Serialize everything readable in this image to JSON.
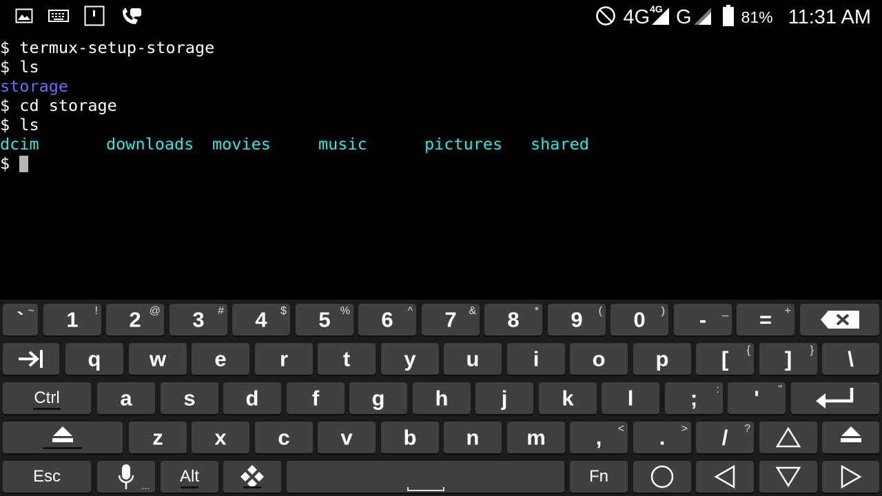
{
  "status_bar": {
    "battery": "81%",
    "time": "11:31 AM",
    "network_primary": "4G",
    "network_primary_tag": "4G",
    "network_secondary": "G",
    "left_icons": [
      "image-notification-icon",
      "keyboard-notification-icon",
      "sd-card-icon",
      "missed-call-icon"
    ]
  },
  "terminal": {
    "lines": [
      "$ termux-setup-storage",
      "$ ls",
      "storage",
      "$ cd storage",
      "$ ls"
    ],
    "ls_output": [
      "dcim",
      "downloads",
      "movies",
      "music",
      "pictures",
      "shared"
    ],
    "prompt": "$ ",
    "colors": {
      "directory_blue": "#6b6bff",
      "directory_cyan": "#2ee6e6",
      "text": "#ffffff",
      "background": "#000000"
    }
  },
  "keyboard": {
    "row1": [
      {
        "label": "`",
        "sub": "~"
      },
      {
        "label": "1",
        "sub": "!"
      },
      {
        "label": "2",
        "sub": "@"
      },
      {
        "label": "3",
        "sub": "#"
      },
      {
        "label": "4",
        "sub": "$"
      },
      {
        "label": "5",
        "sub": "%"
      },
      {
        "label": "6",
        "sub": "^"
      },
      {
        "label": "7",
        "sub": "&"
      },
      {
        "label": "8",
        "sub": "*"
      },
      {
        "label": "9",
        "sub": "("
      },
      {
        "label": "0",
        "sub": ")"
      },
      {
        "label": "-",
        "sub": "_"
      },
      {
        "label": "=",
        "sub": "+"
      }
    ],
    "row2": [
      {
        "label": "q"
      },
      {
        "label": "w"
      },
      {
        "label": "e"
      },
      {
        "label": "r"
      },
      {
        "label": "t"
      },
      {
        "label": "y"
      },
      {
        "label": "u"
      },
      {
        "label": "i"
      },
      {
        "label": "o"
      },
      {
        "label": "p"
      },
      {
        "label": "[",
        "sub": "{"
      },
      {
        "label": "]",
        "sub": "}"
      },
      {
        "label": "\\"
      }
    ],
    "row3": [
      {
        "label": "Ctrl"
      },
      {
        "label": "a"
      },
      {
        "label": "s"
      },
      {
        "label": "d"
      },
      {
        "label": "f"
      },
      {
        "label": "g"
      },
      {
        "label": "h"
      },
      {
        "label": "j"
      },
      {
        "label": "k"
      },
      {
        "label": "l"
      },
      {
        "label": ";",
        "sub": ":"
      },
      {
        "label": "'",
        "sub": "\""
      }
    ],
    "row4": [
      {
        "label": "z"
      },
      {
        "label": "x"
      },
      {
        "label": "c"
      },
      {
        "label": "v"
      },
      {
        "label": "b"
      },
      {
        "label": "n"
      },
      {
        "label": "m"
      },
      {
        "label": ",",
        "sub": "<"
      },
      {
        "label": ".",
        "sub": ">"
      },
      {
        "label": "/",
        "sub": "?"
      }
    ],
    "row5": {
      "esc": "Esc",
      "alt": "Alt",
      "fn": "Fn",
      "mic_sub": "..."
    },
    "icons": [
      "backspace-icon",
      "tab-icon",
      "enter-icon",
      "shift-icon",
      "arrow-up-icon",
      "mic-icon",
      "dpad-icon",
      "circle-icon",
      "arrow-left-icon",
      "arrow-down-icon",
      "arrow-right-icon"
    ]
  }
}
